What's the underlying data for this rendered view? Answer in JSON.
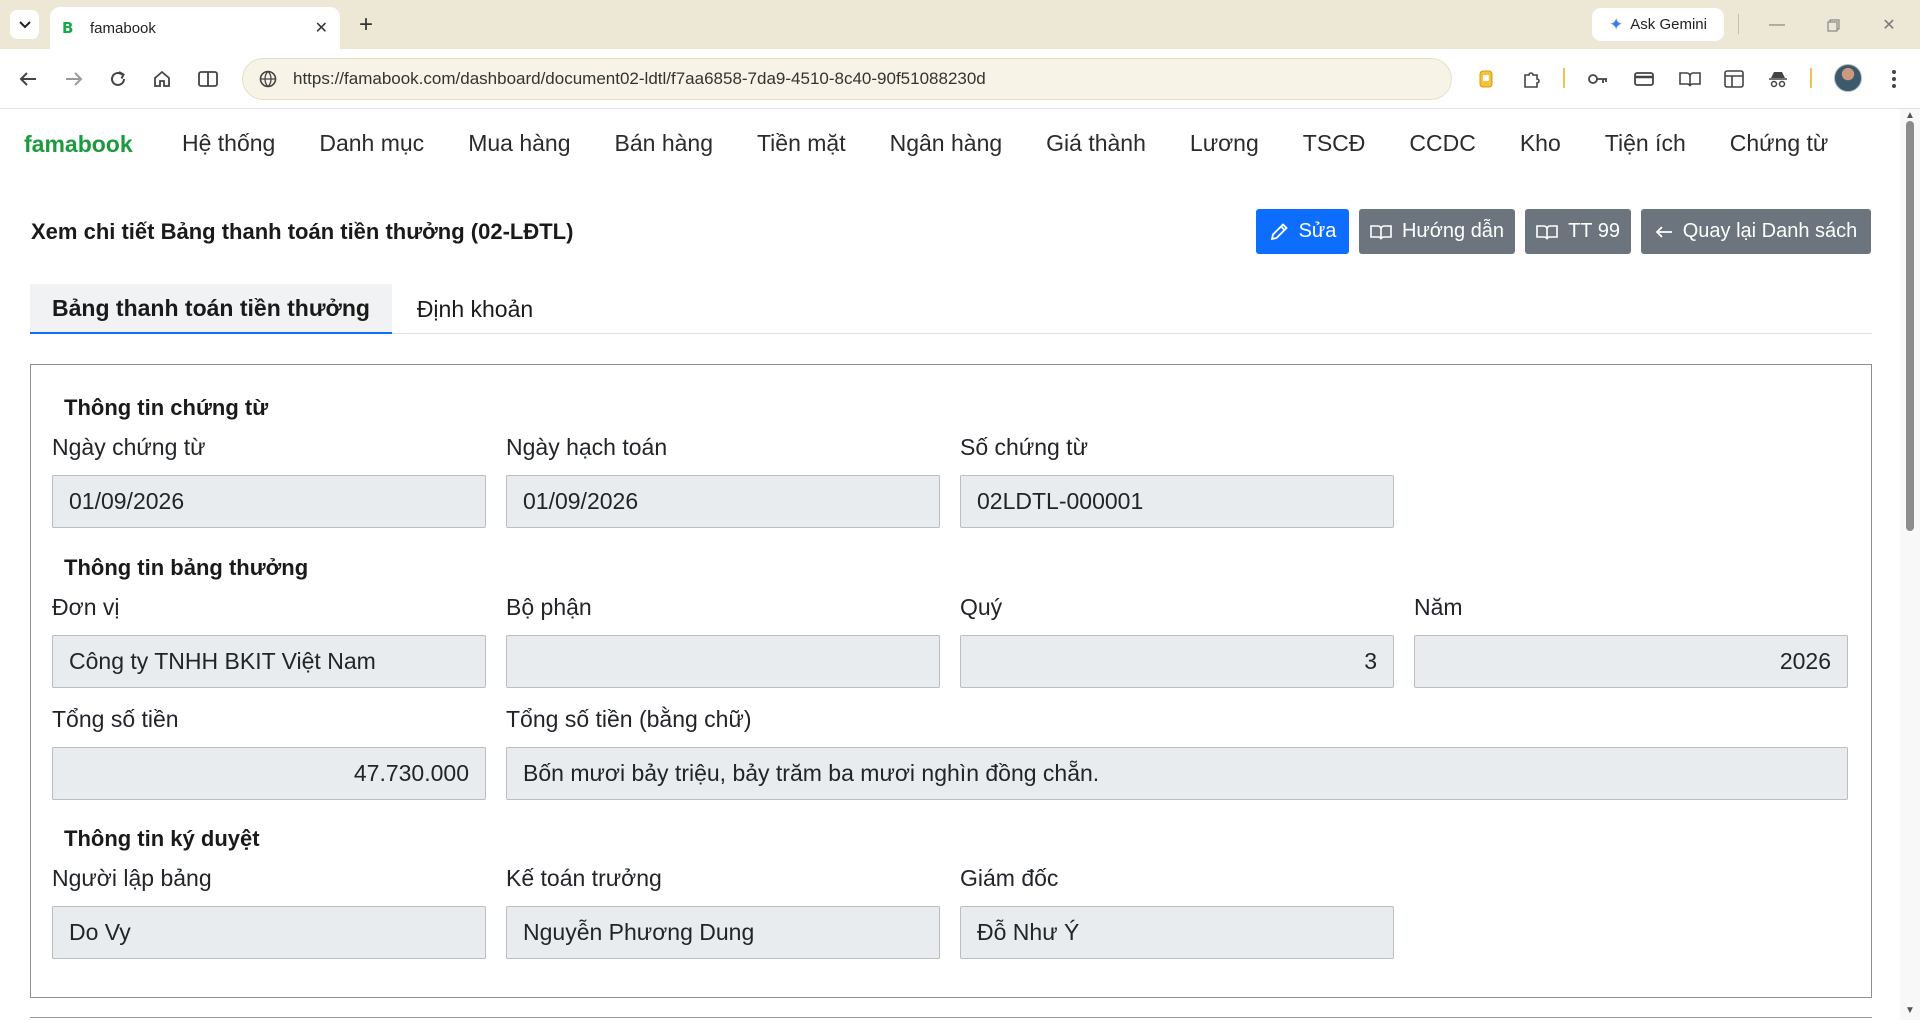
{
  "browser": {
    "tab_title": "famabook",
    "favicon_letter": "B",
    "url": "https://famabook.com/dashboard/document02-ldtl/f7aa6858-7da9-4510-8c40-90f51088230d",
    "gemini_label": "Ask Gemini"
  },
  "app": {
    "brand": "famabook",
    "menu": [
      "Hệ thống",
      "Danh mục",
      "Mua hàng",
      "Bán hàng",
      "Tiền mặt",
      "Ngân hàng",
      "Giá thành",
      "Lương",
      "TSCĐ",
      "CCDC",
      "Kho",
      "Tiện ích",
      "Chứng từ"
    ]
  },
  "header": {
    "title": "Xem chi tiết Bảng thanh toán tiền thưởng (02-LĐTL)",
    "edit_label": "Sửa",
    "guide_label": "Hướng dẫn",
    "tt99_label": "TT 99",
    "back_label": "Quay lại Danh sách"
  },
  "tabs": {
    "main": "Bảng thanh toán tiền thưởng",
    "accounting": "Định khoản"
  },
  "doc_info": {
    "title": "Thông tin chứng từ",
    "doc_date_label": "Ngày chứng từ",
    "doc_date": "01/09/2026",
    "post_date_label": "Ngày hạch toán",
    "post_date": "01/09/2026",
    "doc_no_label": "Số chứng từ",
    "doc_no": "02LDTL-000001"
  },
  "bonus_info": {
    "title": "Thông tin bảng thưởng",
    "unit_label": "Đơn vị",
    "unit": "Công ty TNHH BKIT Việt Nam",
    "dept_label": "Bộ phận",
    "dept": "",
    "quarter_label": "Quý",
    "quarter": "3",
    "year_label": "Năm",
    "year": "2026",
    "total_label": "Tổng số tiền",
    "total": "47.730.000",
    "total_words_label": "Tổng số tiền (bằng chữ)",
    "total_words": "Bốn mươi bảy triệu, bảy trăm ba mươi nghìn đồng chẵn."
  },
  "approval": {
    "title": "Thông tin ký duyệt",
    "preparer_label": "Người lập bảng",
    "preparer": "Do Vy",
    "chief_accountant_label": "Kế toán trưởng",
    "chief_accountant": "Nguyễn Phương Dung",
    "director_label": "Giám đốc",
    "director": "Đỗ Như Ý"
  }
}
